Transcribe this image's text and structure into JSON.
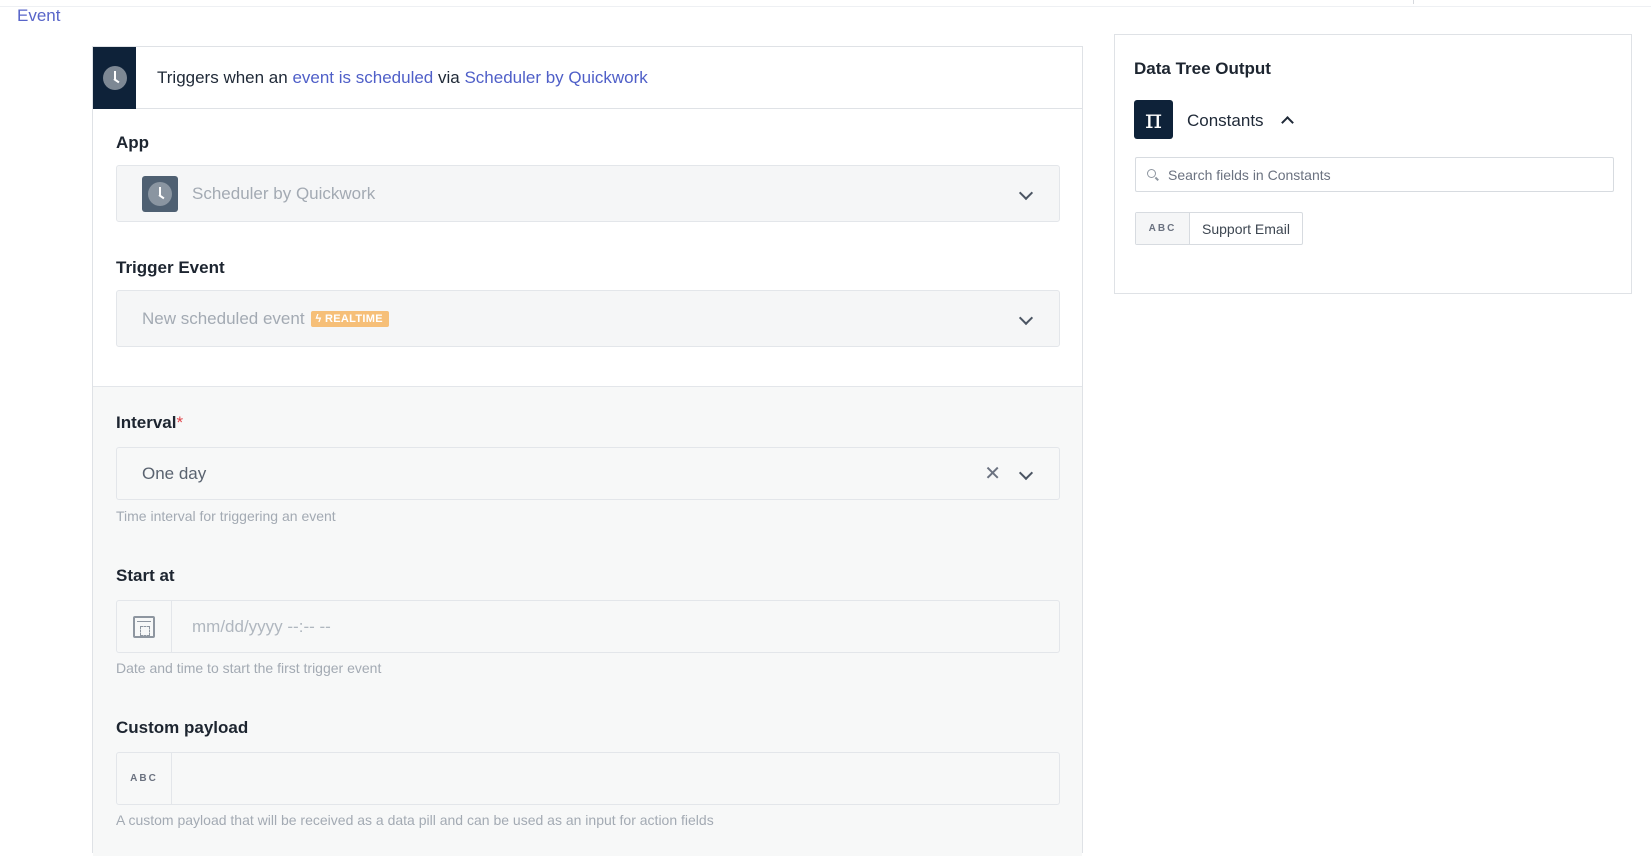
{
  "header": {
    "tab_label": "Event"
  },
  "trigger": {
    "prefix": "Triggers when an ",
    "event_link": "event is scheduled",
    "via": " via ",
    "app_link": "Scheduler by Quickwork",
    "icon": "clock-icon"
  },
  "form": {
    "app": {
      "label": "App",
      "value": "Scheduler by Quickwork",
      "icon": "clock-icon"
    },
    "trigger_event": {
      "label": "Trigger Event",
      "value": "New scheduled event",
      "badge": "REALTIME"
    },
    "interval": {
      "label": "Interval",
      "required_mark": "*",
      "value": "One day",
      "clear": "✕",
      "helper": "Time interval for triggering an event"
    },
    "start_at": {
      "label": "Start at",
      "placeholder": "mm/dd/yyyy --:-- --",
      "helper": "Date and time to start the first trigger event",
      "icon": "calendar-clock-icon"
    },
    "custom_payload": {
      "label": "Custom payload",
      "type_tag": "ABC",
      "helper": "A custom payload that will be received as a data pill and can be used as an input for action fields"
    }
  },
  "data_tree": {
    "title": "Data Tree Output",
    "group": {
      "symbol": "π",
      "label": "Constants",
      "expanded": true
    },
    "search": {
      "placeholder": "Search fields in Constants"
    },
    "pills": [
      {
        "type": "ABC",
        "label": "Support Email"
      }
    ]
  },
  "colors": {
    "accent": "#4f5fc8",
    "navy": "#0e2239",
    "badge": "#f6bf78",
    "required": "#e0444a"
  }
}
